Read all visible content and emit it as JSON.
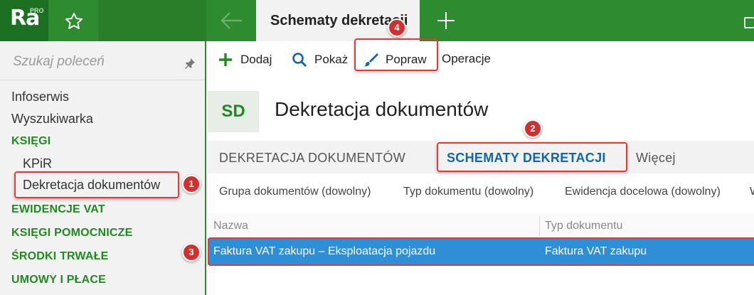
{
  "app": {
    "logo_text": "Ra",
    "logo_badge": "PRO",
    "active_tab": "Schematy dekretacji"
  },
  "sidebar": {
    "search_placeholder": "Szukaj poleceń",
    "items": [
      {
        "label": "Infoserwis",
        "kind": "item"
      },
      {
        "label": "Wyszukiwarka",
        "kind": "item"
      },
      {
        "label": "KSIĘGI",
        "kind": "section"
      },
      {
        "label": "KPiR",
        "kind": "sub"
      },
      {
        "label": "Dekretacja dokumentów",
        "kind": "sub"
      },
      {
        "label": "EWIDENCJE VAT",
        "kind": "section"
      },
      {
        "label": "KSIĘGI POMOCNICZE",
        "kind": "section"
      },
      {
        "label": "ŚRODKI TRWAŁE",
        "kind": "section"
      },
      {
        "label": "UMOWY I PŁACE",
        "kind": "section"
      }
    ]
  },
  "toolbar": {
    "add_label": "Dodaj",
    "show_label": "Pokaż",
    "edit_label": "Popraw",
    "operations_label": "Operacje"
  },
  "page": {
    "badge": "SD",
    "title": "Dekretacja dokumentów"
  },
  "tabs": [
    {
      "label": "DEKRETACJA DOKUMENTÓW",
      "selected": false
    },
    {
      "label": "SCHEMATY DEKRETACJI",
      "selected": true
    },
    {
      "label": "Więcej",
      "selected": false
    }
  ],
  "filters": [
    "Grupa dokumentów (dowolny)",
    "Typ dokumentu (dowolny)",
    "Ewidencja docelowa (dowolny)",
    "W"
  ],
  "table": {
    "columns": [
      "Nazwa",
      "Typ dokumentu"
    ],
    "rows": [
      [
        "Faktura VAT zakupu – Eksploatacja pojazdu",
        "Faktura VAT zakupu"
      ]
    ]
  },
  "annotations": [
    "1",
    "2",
    "3",
    "4"
  ],
  "colors": {
    "brand_green": "#2f8b2f",
    "section_green": "#1f8a1f",
    "selected_row": "#2e8fd6",
    "annotation_red": "#e53935",
    "tab_blue": "#1565a8"
  }
}
